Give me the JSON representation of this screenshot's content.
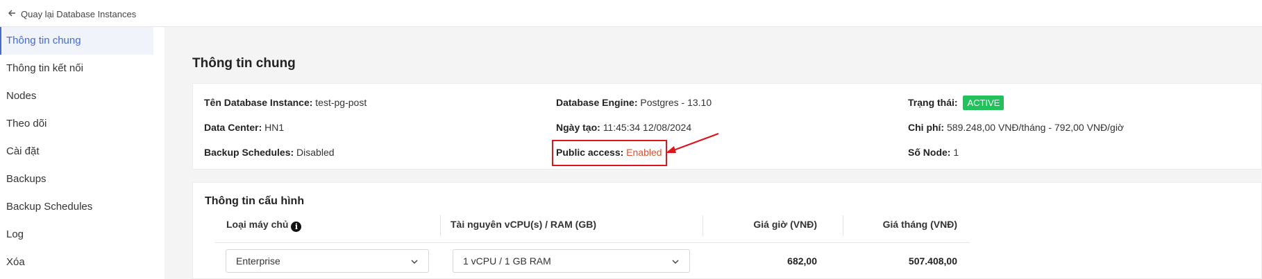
{
  "topbar": {
    "back_label": "Quay lại Database Instances"
  },
  "sidebar": {
    "items": [
      {
        "label": "Thông tin chung"
      },
      {
        "label": "Thông tin kết nối"
      },
      {
        "label": "Nodes"
      },
      {
        "label": "Theo dõi"
      },
      {
        "label": "Cài đặt"
      },
      {
        "label": "Backups"
      },
      {
        "label": "Backup Schedules"
      },
      {
        "label": "Log"
      },
      {
        "label": "Xóa"
      }
    ]
  },
  "main": {
    "title": "Thông tin chung",
    "info": {
      "instance_name_label": "Tên Database Instance:",
      "instance_name_value": "test-pg-post",
      "data_center_label": "Data Center:",
      "data_center_value": "HN1",
      "backup_label": "Backup Schedules:",
      "backup_value": "Disabled",
      "engine_label": "Database Engine:",
      "engine_value": "Postgres - 13.10",
      "created_label": "Ngày tạo:",
      "created_value": "11:45:34 12/08/2024",
      "public_label": "Public access:",
      "public_value": "Enabled",
      "status_label": "Trạng thái:",
      "status_value": "ACTIVE",
      "cost_label": "Chi phí:",
      "cost_value": "589.248,00 VNĐ/tháng - 792,00 VNĐ/giờ",
      "nodes_label": "Số Node:",
      "nodes_value": "1"
    },
    "config": {
      "title": "Thông tin cấu hình",
      "headers": {
        "server_type": "Loại máy chủ",
        "resources": "Tài nguyên vCPU(s) / RAM (GB)",
        "hourly": "Giá giờ (VNĐ)",
        "monthly": "Giá tháng (VNĐ)"
      },
      "server_type_value": "Enterprise",
      "resources_value": "1 vCPU / 1 GB RAM",
      "hourly_value": "682,00",
      "monthly_value": "507.408,00"
    }
  },
  "colors": {
    "accent": "#3f6bd9",
    "status_active": "#22c25a",
    "enabled": "#e0502c",
    "highlight": "#e0141c"
  },
  "icons": [
    "arrow-left-icon",
    "info-icon",
    "chevron-down-icon"
  ]
}
